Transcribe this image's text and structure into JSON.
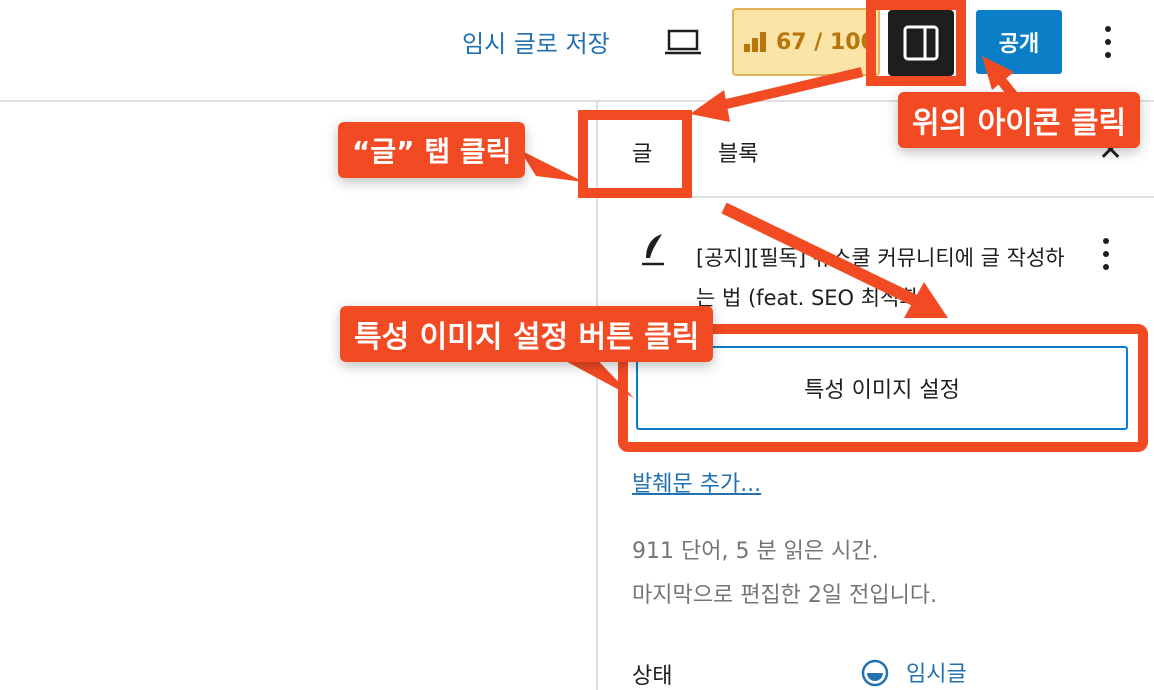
{
  "topbar": {
    "save_draft": "임시 글로 저장",
    "seo_score": "67 / 100",
    "publish": "공개"
  },
  "sidebar": {
    "tabs": [
      "글",
      "블록"
    ],
    "post_title": "[공지][필독] 뉴스쿨 커뮤니티에 글 작성하는 법 (feat. SEO 최적화)",
    "featured_image_button": "특성 이미지 설정",
    "excerpt_link": "발췌문 추가...",
    "stats_words": "911 단어, 5 분 읽은 시간.",
    "stats_edited": "마지막으로 편집한 2일 전입니다.",
    "status_label": "상태",
    "status_value": "임시글"
  },
  "annotations": {
    "click_post_tab": "“글” 탭 클릭",
    "click_icon_above": "위의 아이콘 클릭",
    "click_featured_image": "특성 이미지 설정 버튼 클릭"
  },
  "colors": {
    "annotation": "#f24b24",
    "accent": "#0a7fc7",
    "link": "#2271b1"
  }
}
